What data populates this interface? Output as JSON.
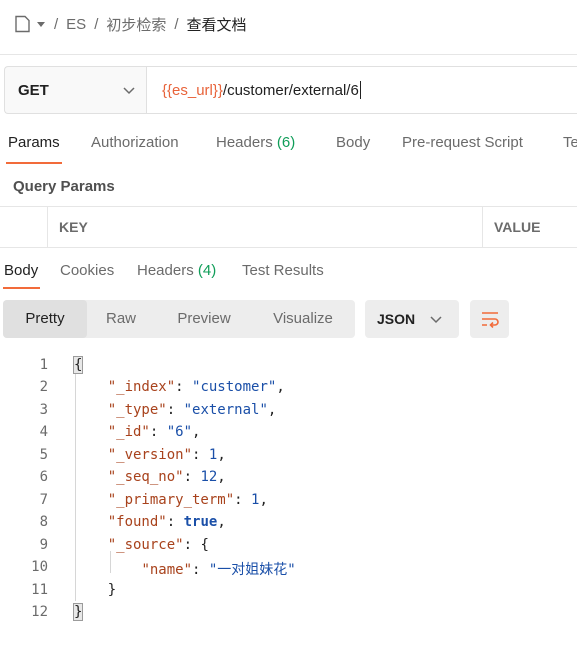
{
  "breadcrumb": {
    "collection": "ES",
    "folder": "初步检索",
    "request": "查看文档"
  },
  "request": {
    "method": "GET",
    "url_var": "{{es_url}}",
    "url_path": "/customer/external/6"
  },
  "req_tabs": [
    {
      "label": "Params",
      "count": ""
    },
    {
      "label": "Authorization",
      "count": ""
    },
    {
      "label": "Headers",
      "count": "(6)"
    },
    {
      "label": "Body",
      "count": ""
    },
    {
      "label": "Pre-request Script",
      "count": ""
    },
    {
      "label": "Te",
      "count": ""
    }
  ],
  "query_params": {
    "title": "Query Params",
    "key_header": "KEY",
    "value_header": "VALUE"
  },
  "resp_tabs": [
    {
      "label": "Body",
      "count": ""
    },
    {
      "label": "Cookies",
      "count": ""
    },
    {
      "label": "Headers",
      "count": "(4)"
    },
    {
      "label": "Test Results",
      "count": ""
    }
  ],
  "view_modes": [
    "Pretty",
    "Raw",
    "Preview",
    "Visualize"
  ],
  "format": "JSON",
  "line_numbers": [
    "1",
    "2",
    "3",
    "4",
    "5",
    "6",
    "7",
    "8",
    "9",
    "10",
    "11",
    "12"
  ],
  "json": {
    "open": "{",
    "close": "}",
    "index_key": "\"_index\"",
    "index_val": "\"customer\"",
    "type_key": "\"_type\"",
    "type_val": "\"external\"",
    "id_key": "\"_id\"",
    "id_val": "\"6\"",
    "version_key": "\"_version\"",
    "version_val": "1",
    "seq_key": "\"_seq_no\"",
    "seq_val": "12",
    "term_key": "\"_primary_term\"",
    "term_val": "1",
    "found_key": "\"found\"",
    "found_val": "true",
    "source_key": "\"_source\"",
    "source_open": "{",
    "name_key": "\"name\"",
    "name_val": "\"一对姐妹花\"",
    "source_close": "}"
  },
  "colors": {
    "accent": "#f26b3a",
    "count_green": "#0f9d58",
    "url_var": "#e8633a"
  }
}
